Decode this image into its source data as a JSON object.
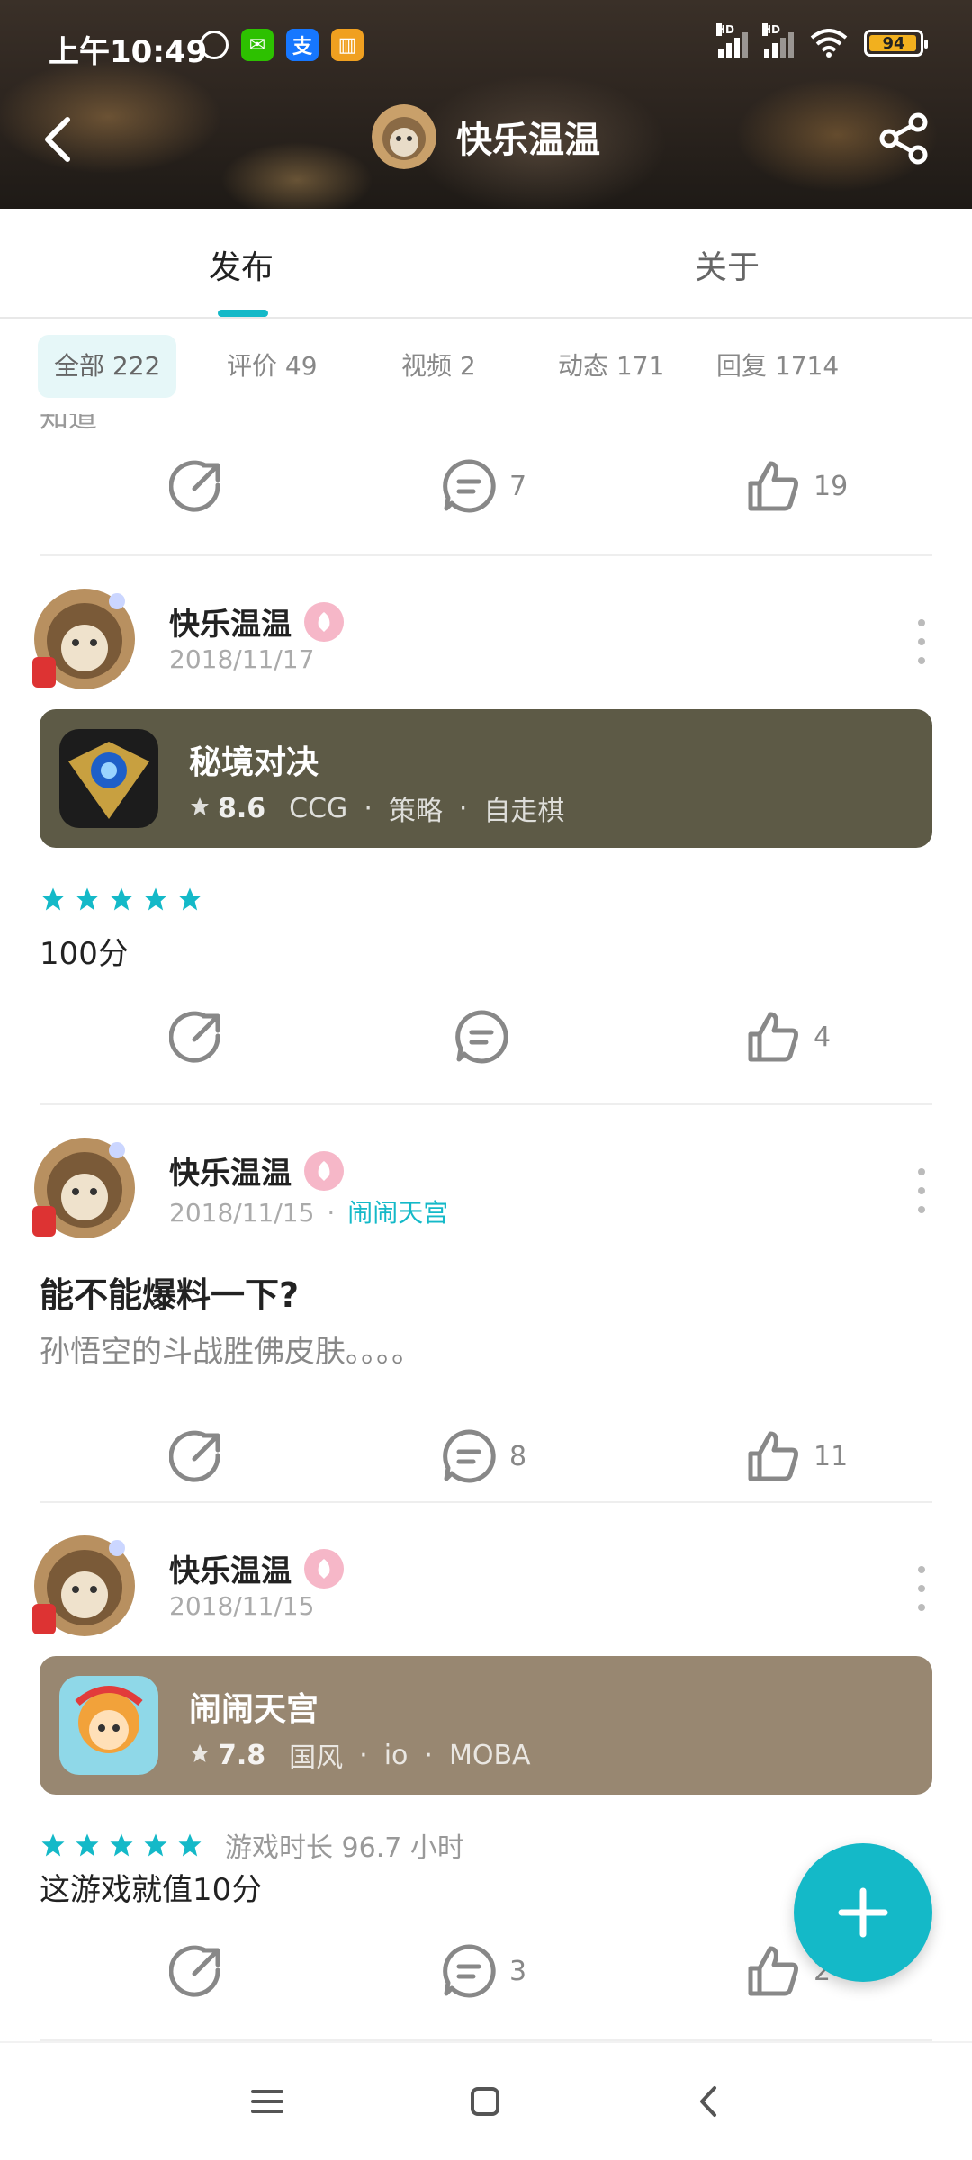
{
  "status_bar": {
    "time": "上午10:49",
    "battery": "94",
    "network_1": "HD",
    "network_2": "HD"
  },
  "header": {
    "title": "快乐温温"
  },
  "tabs": [
    {
      "label": "发布",
      "active": true
    },
    {
      "label": "关于",
      "active": false
    }
  ],
  "filters": [
    {
      "label": "全部 222",
      "active": true
    },
    {
      "label": "评价 49",
      "active": false
    },
    {
      "label": "视频 2",
      "active": false
    },
    {
      "label": "动态 171",
      "active": false
    },
    {
      "label": "回复 1714",
      "active": false
    }
  ],
  "feed": {
    "prev_partial_text": "知道",
    "prev_actions": {
      "comments": "7",
      "likes": "19"
    },
    "posts": [
      {
        "author": "快乐温温",
        "date": "2018/11/17",
        "game_card": {
          "name": "秘境对决",
          "score": "8.6",
          "tags": [
            "CCG",
            "策略",
            "自走棋"
          ],
          "bg_color": "#5d5a46"
        },
        "rating_stars": 5,
        "text": "100分",
        "actions": {
          "comments": "",
          "likes": "4"
        }
      },
      {
        "author": "快乐温温",
        "date": "2018/11/15",
        "game_tag": "闹闹天宫",
        "title": "能不能爆料一下?",
        "excerpt": "孙悟空的斗战胜佛皮肤。。。。",
        "actions": {
          "comments": "8",
          "likes": "11"
        }
      },
      {
        "author": "快乐温温",
        "date": "2018/11/15",
        "game_card": {
          "name": "闹闹天宫",
          "score": "7.8",
          "tags": [
            "国风",
            "io",
            "MOBA"
          ],
          "bg_color": "#988771"
        },
        "rating_stars": 5,
        "play_time": "游戏时长 96.7 小时",
        "text": "这游戏就值10分",
        "actions": {
          "comments": "3",
          "likes": "2"
        }
      }
    ]
  },
  "colors": {
    "accent": "#14b9c8",
    "badge_pink": "#f6b7c8"
  },
  "icons": {
    "back": "chevron-left-icon",
    "share": "share-icon",
    "repost": "repost-arrow-icon",
    "comment": "comment-bubble-icon",
    "like": "thumbs-up-icon",
    "more": "more-vertical-icon",
    "fab": "plus-icon"
  }
}
